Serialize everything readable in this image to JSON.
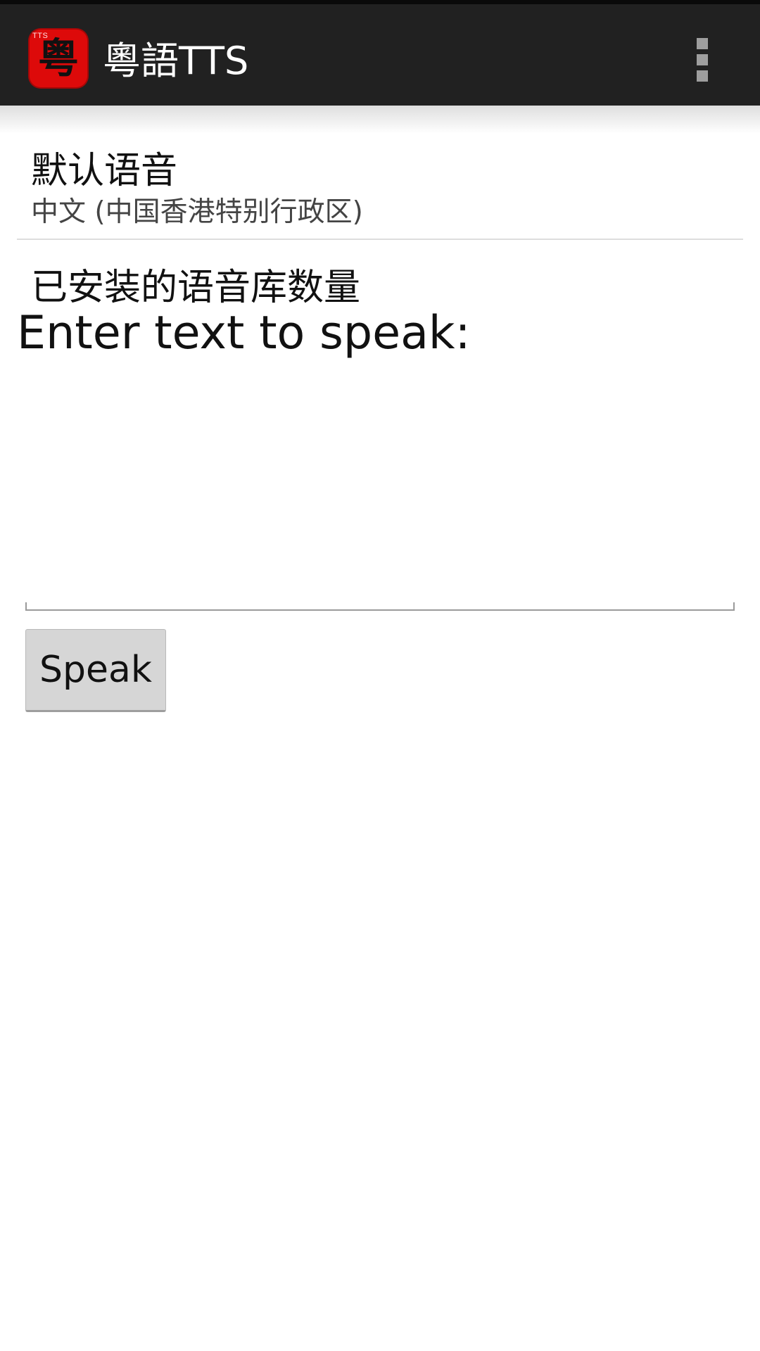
{
  "app_bar": {
    "title": "粵語TTS",
    "icon": {
      "name": "app-logo-icon",
      "badge_text": "TTS",
      "glyph": "粤",
      "background_color": "#dd0a0a"
    },
    "menu_icon": "overflow-menu-icon",
    "background_color": "#212121"
  },
  "preferences": [
    {
      "title": "默认语音",
      "summary": "中文 (中国香港特别行政区)"
    },
    {
      "title": "已安装的语音库数量"
    }
  ],
  "speak_section": {
    "prompt": "Enter text to speak:",
    "input_value": "",
    "button_label": "Speak"
  }
}
